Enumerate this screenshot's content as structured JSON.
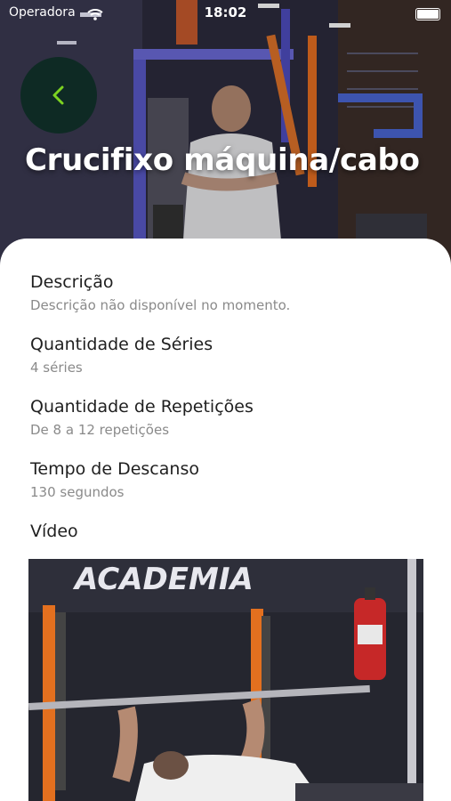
{
  "status_bar": {
    "carrier": "Operadora",
    "time": "18:02"
  },
  "header": {
    "title": "Crucifixo máquina/cabo",
    "back_icon": "chevron-left-icon"
  },
  "colors": {
    "accent": "#7dd321",
    "back_bg": "#0e2a24"
  },
  "details": [
    {
      "label": "Descrição",
      "value": "Descrição não disponível no momento."
    },
    {
      "label": "Quantidade de Séries",
      "value": "4 séries"
    },
    {
      "label": "Quantidade de Repetições",
      "value": "De 8 a 12 repetições"
    },
    {
      "label": "Tempo de Descanso",
      "value": "130 segundos"
    }
  ],
  "video": {
    "label": "Vídeo",
    "wall_text": "ACADEMIA"
  }
}
